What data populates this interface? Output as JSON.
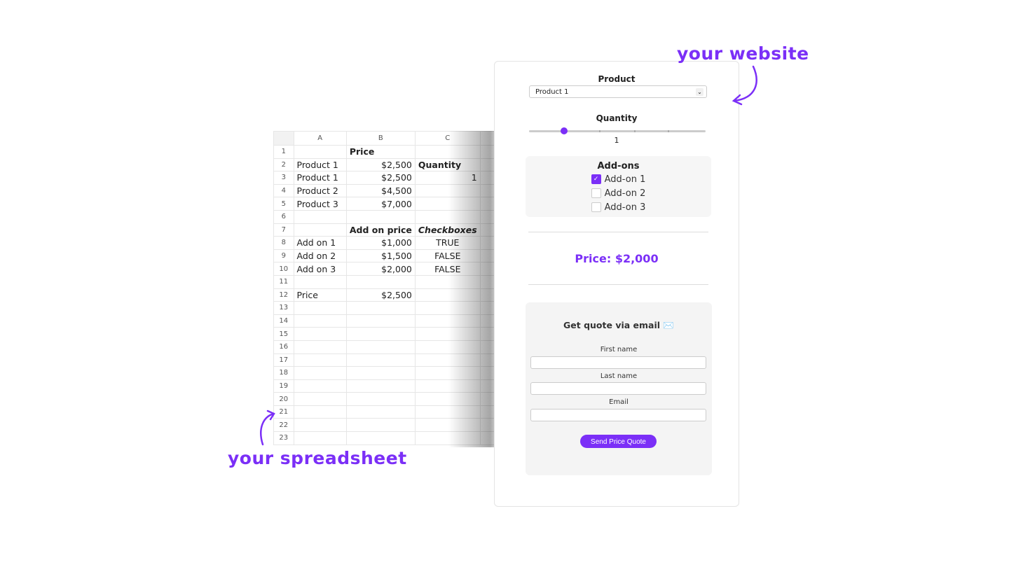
{
  "annotations": {
    "website": "your website",
    "spreadsheet": "your spreadsheet"
  },
  "spreadsheet": {
    "columns": [
      "A",
      "B",
      "C"
    ],
    "rows": [
      [
        "1",
        "",
        "Price",
        ""
      ],
      [
        "2",
        "Product 1",
        "$2,500",
        "Quantity"
      ],
      [
        "3",
        "Product 1",
        "$2,500",
        "1"
      ],
      [
        "4",
        "Product 2",
        "$4,500",
        ""
      ],
      [
        "5",
        "Product 3",
        "$7,000",
        ""
      ],
      [
        "6",
        "",
        "",
        ""
      ],
      [
        "7",
        "",
        "Add on price",
        "Checkboxes"
      ],
      [
        "8",
        "Add on 1",
        "$1,000",
        "TRUE"
      ],
      [
        "9",
        "Add on 2",
        "$1,500",
        "FALSE"
      ],
      [
        "10",
        "Add on 3",
        "$2,000",
        "FALSE"
      ],
      [
        "11",
        "",
        "",
        ""
      ],
      [
        "12",
        "Price",
        "$2,500",
        ""
      ],
      [
        "13",
        "",
        "",
        ""
      ],
      [
        "14",
        "",
        "",
        ""
      ],
      [
        "15",
        "",
        "",
        ""
      ],
      [
        "16",
        "",
        "",
        ""
      ],
      [
        "17",
        "",
        "",
        ""
      ],
      [
        "18",
        "",
        "",
        ""
      ],
      [
        "19",
        "",
        "",
        ""
      ],
      [
        "20",
        "",
        "",
        ""
      ],
      [
        "21",
        "",
        "",
        ""
      ],
      [
        "22",
        "",
        "",
        ""
      ],
      [
        "23",
        "",
        "",
        ""
      ]
    ]
  },
  "website": {
    "product_label": "Product",
    "product_value": "Product 1",
    "quantity_label": "Quantity",
    "quantity_value": "1",
    "quantity_fraction": 0.2,
    "addons_label": "Add-ons",
    "addons": [
      {
        "label": "Add-on 1",
        "checked": true
      },
      {
        "label": "Add-on 2",
        "checked": false
      },
      {
        "label": "Add-on 3",
        "checked": false
      }
    ],
    "price": "Price: $2,000",
    "quote_title": "Get quote via email ✉️",
    "first_name_label": "First name",
    "last_name_label": "Last name",
    "email_label": "Email",
    "send_label": "Send Price Quote"
  },
  "colors": {
    "accent": "#7b2ff7"
  }
}
